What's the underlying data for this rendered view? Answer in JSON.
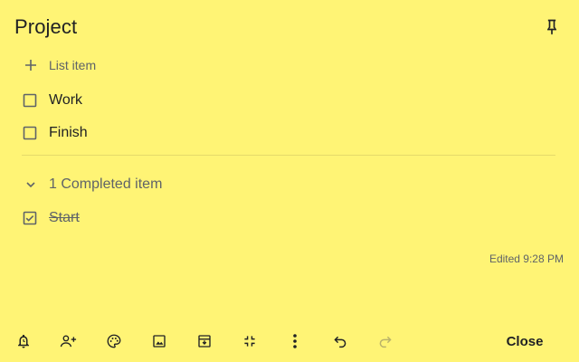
{
  "note": {
    "title": "Project",
    "add_placeholder": "List item",
    "items": [
      {
        "label": "Work",
        "checked": false
      },
      {
        "label": "Finish",
        "checked": false
      }
    ],
    "completed_label": "1 Completed item",
    "completed_items": [
      {
        "label": "Start",
        "checked": true
      }
    ],
    "edited": "Edited 9:28 PM"
  },
  "toolbar": {
    "icons": [
      "reminder-icon",
      "collaborator-icon",
      "palette-icon",
      "image-icon",
      "archive-icon",
      "collapse-icon",
      "more-icon",
      "undo-icon",
      "redo-icon"
    ],
    "close_label": "Close"
  },
  "colors": {
    "background": "#fff475",
    "text": "#202124",
    "muted": "#5f6368"
  }
}
